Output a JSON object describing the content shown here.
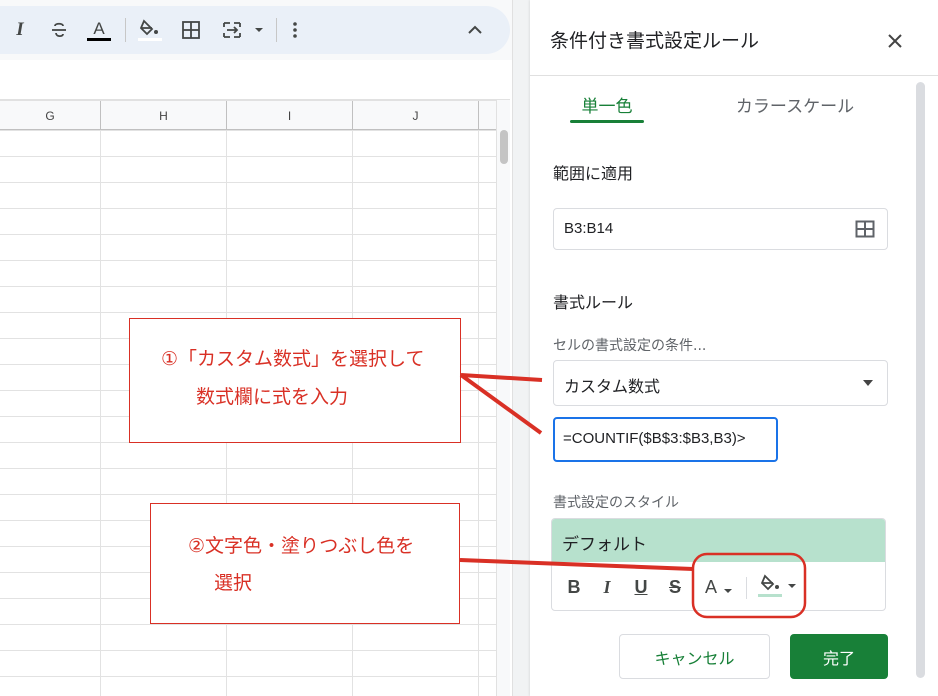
{
  "toolbar": {
    "icons": [
      "italic-icon",
      "strikethrough-icon",
      "text-color-icon",
      "fill-color-icon",
      "borders-icon",
      "merge-cells-icon",
      "more-icon",
      "collapse-icon"
    ],
    "italic": "I",
    "text_color": "A"
  },
  "sheet": {
    "columns": [
      "G",
      "H",
      "I",
      "J"
    ]
  },
  "panel": {
    "title": "条件付き書式設定ルール",
    "close": "×",
    "tabs": [
      {
        "label": "単一色",
        "active": true
      },
      {
        "label": "カラースケール",
        "active": false
      }
    ],
    "range_label": "範囲に適用",
    "range_value": "B3:B14",
    "rules_label": "書式ルール",
    "condition_label": "セルの書式設定の条件...",
    "condition_value": "カスタム数式",
    "formula_value": "=COUNTIF($B$3:$B3,B3)>",
    "style_label": "書式設定のスタイル",
    "style_preview": "デフォルト",
    "format_buttons": {
      "bold": "B",
      "italic": "I",
      "underline": "U",
      "strike": "S",
      "text_color": "A"
    },
    "cancel_label": "キャンセル",
    "done_label": "完了"
  },
  "annotations": {
    "callout1": {
      "line1": "①「カスタム数式」を選択して",
      "line2": "数式欄に式を入力"
    },
    "callout2": {
      "line1": "②文字色・塗りつぶし色を",
      "line2": "選択"
    }
  },
  "colors": {
    "accent_green": "#188038",
    "preview_fill": "#b7e1cd",
    "focus_blue": "#1a73e8",
    "annotation_red": "#d93025"
  }
}
